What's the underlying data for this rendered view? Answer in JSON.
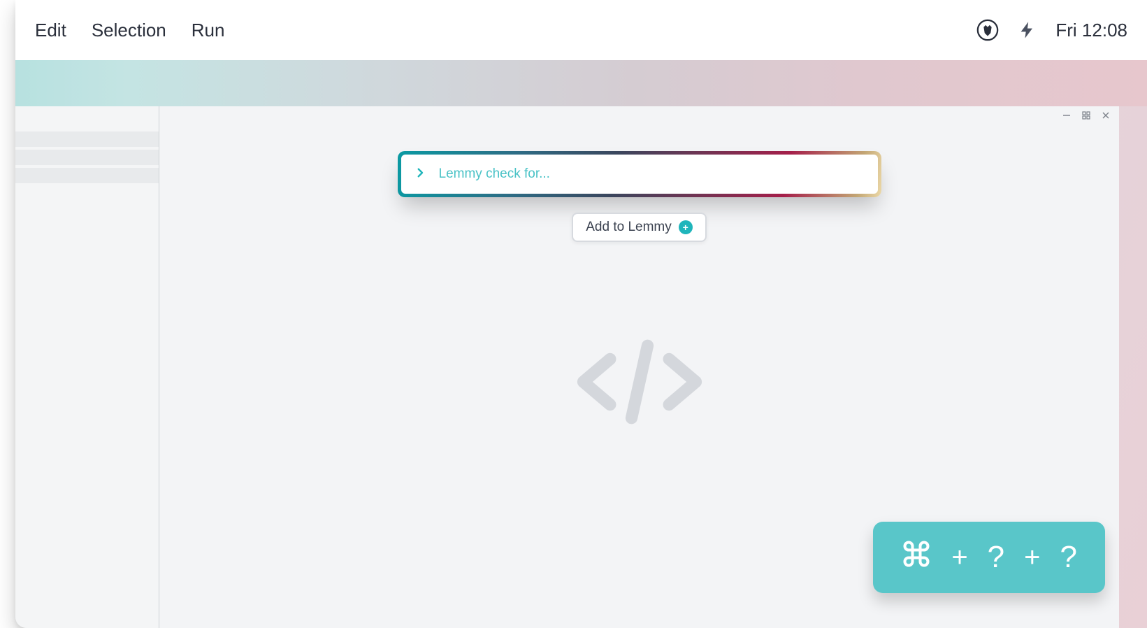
{
  "menubar": {
    "items": [
      "Edit",
      "Selection",
      "Run"
    ],
    "clock": "Fri 12:08"
  },
  "search": {
    "placeholder": "Lemmy check for..."
  },
  "add_button": {
    "label": "Add to Lemmy"
  },
  "shortcut": {
    "key1": "?",
    "key2": "?",
    "sep": "+"
  },
  "colors": {
    "accent": "#1fb5bb",
    "pill": "#59c6c9"
  }
}
